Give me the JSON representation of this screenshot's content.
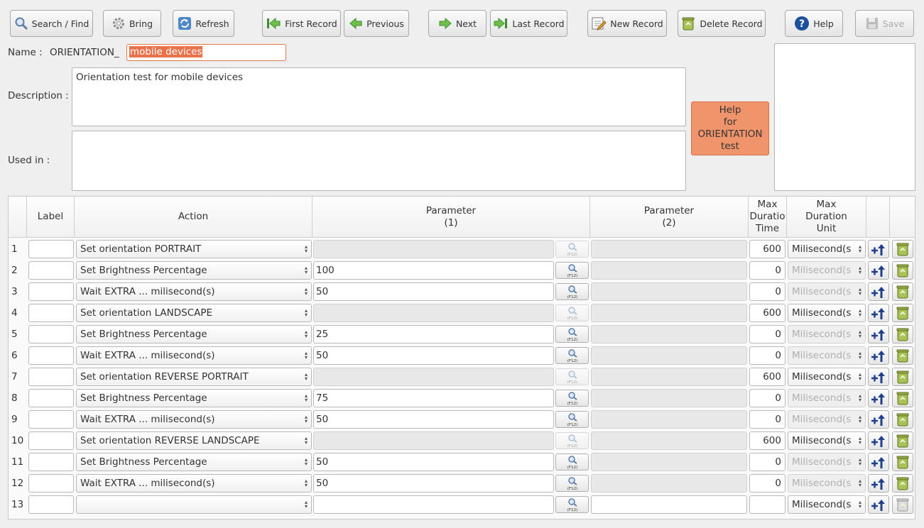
{
  "toolbar": {
    "search": "Search / Find",
    "bring": "Bring",
    "refresh": "Refresh",
    "first": "First Record",
    "previous": "Previous",
    "next": "Next",
    "last": "Last Record",
    "new": "New Record",
    "delete": "Delete Record",
    "help": "Help",
    "save": "Save"
  },
  "form": {
    "name_label": "Name :",
    "name_prefix": "ORIENTATION_",
    "name_value": "mobile devices",
    "description_label": "Description :",
    "description_value": "Orientation test for mobile devices",
    "used_in_label": "Used in :",
    "help_button": {
      "l1": "Help",
      "l2": "for",
      "l3": "ORIENTATION",
      "l4": "test"
    }
  },
  "table": {
    "headers": {
      "label": "Label",
      "action": "Action",
      "param1": "Parameter",
      "param1_sub": "(1)",
      "param2": "Parameter",
      "param2_sub": "(2)",
      "max": "Max",
      "duration_cut": "Duratio",
      "time": "Time",
      "unit_max": "Max",
      "unit_duration": "Duration",
      "unit": "Unit"
    },
    "search_key_hint": "(F12)",
    "rows": [
      {
        "n": "1",
        "action": "Set orientation PORTRAIT",
        "p1": "",
        "time": "600",
        "unit": "Milisecond(s"
      },
      {
        "n": "2",
        "action": "Set Brightness Percentage",
        "p1": "100",
        "time": "0",
        "unit": "Milisecond(s"
      },
      {
        "n": "3",
        "action": "Wait EXTRA ... milisecond(s)",
        "p1": "50",
        "time": "0",
        "unit": "Milisecond(s"
      },
      {
        "n": "4",
        "action": "Set orientation LANDSCAPE",
        "p1": "",
        "time": "600",
        "unit": "Milisecond(s"
      },
      {
        "n": "5",
        "action": "Set Brightness Percentage",
        "p1": "25",
        "time": "0",
        "unit": "Milisecond(s"
      },
      {
        "n": "6",
        "action": "Wait EXTRA ... milisecond(s)",
        "p1": "50",
        "time": "0",
        "unit": "Milisecond(s"
      },
      {
        "n": "7",
        "action": "Set orientation REVERSE PORTRAIT",
        "p1": "",
        "time": "600",
        "unit": "Milisecond(s"
      },
      {
        "n": "8",
        "action": "Set Brightness Percentage",
        "p1": "75",
        "time": "0",
        "unit": "Milisecond(s"
      },
      {
        "n": "9",
        "action": "Wait EXTRA ... milisecond(s)",
        "p1": "50",
        "time": "0",
        "unit": "Milisecond(s"
      },
      {
        "n": "10",
        "action": "Set orientation REVERSE LANDSCAPE",
        "p1": "",
        "time": "600",
        "unit": "Milisecond(s"
      },
      {
        "n": "11",
        "action": "Set Brightness Percentage",
        "p1": "50",
        "time": "0",
        "unit": "Milisecond(s"
      },
      {
        "n": "12",
        "action": "Wait EXTRA ... milisecond(s)",
        "p1": "50",
        "time": "0",
        "unit": "Milisecond(s"
      },
      {
        "n": "13",
        "action": "",
        "p1": "",
        "time": "",
        "unit": "Milisecond(s"
      }
    ]
  }
}
